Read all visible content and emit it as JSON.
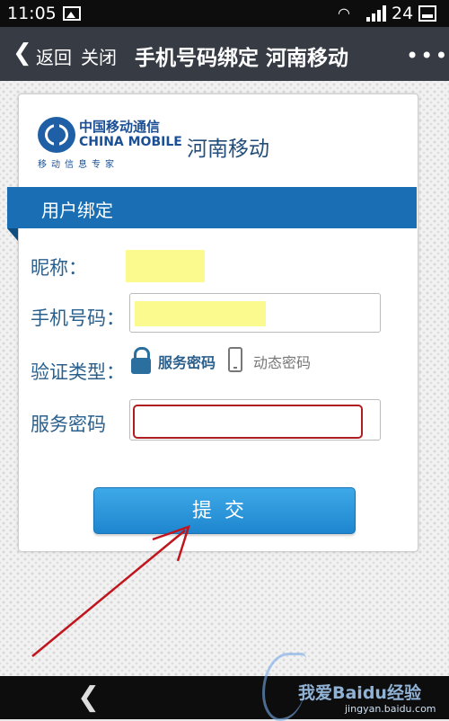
{
  "status_bar": {
    "time": "11:05",
    "battery": "24"
  },
  "nav": {
    "back_label": "返回",
    "close_label": "关闭",
    "title": "手机号码绑定 河南移动",
    "more": "•••"
  },
  "logo": {
    "cn": "中国移动通信",
    "en": "CHINA MOBILE",
    "slogan": "移动信息专家"
  },
  "brand_name": "河南移动",
  "section_title": "用户绑定",
  "form": {
    "nickname_label": "昵称：",
    "phone_label": "手机号码：",
    "auth_type_label": "验证类型：",
    "auth_options": [
      "服务密码",
      "动态密码"
    ],
    "selected_auth": "服务密码",
    "password_label": "服务密码",
    "submit_label": "提交"
  },
  "watermark": {
    "text": "我爱Baidu经验",
    "url": "jingyan.baidu.com"
  },
  "colors": {
    "accent": "#1a6fb4",
    "nav_bg": "#363b44",
    "error": "#b01d20",
    "highlight": "#fbfa8f",
    "annotation": "#c0151d"
  }
}
